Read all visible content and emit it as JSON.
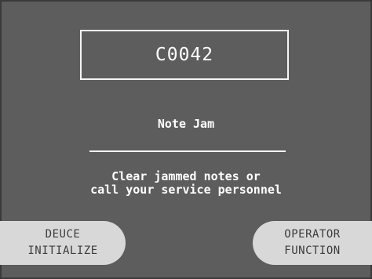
{
  "screen": {
    "error_code": "C0042",
    "title": "Note Jam",
    "message": {
      "line1": "Clear jammed notes or",
      "line2": "call your service personnel"
    }
  },
  "softkeys": {
    "left": {
      "line1": "DEUCE",
      "line2": "INITIALIZE"
    },
    "right": {
      "line1": "OPERATOR",
      "line2": "FUNCTION"
    }
  },
  "colors": {
    "background": "#5d5d5d",
    "text": "#ffffff",
    "softkey_bg": "#d8d8d8",
    "softkey_text": "#3c3c3c"
  }
}
